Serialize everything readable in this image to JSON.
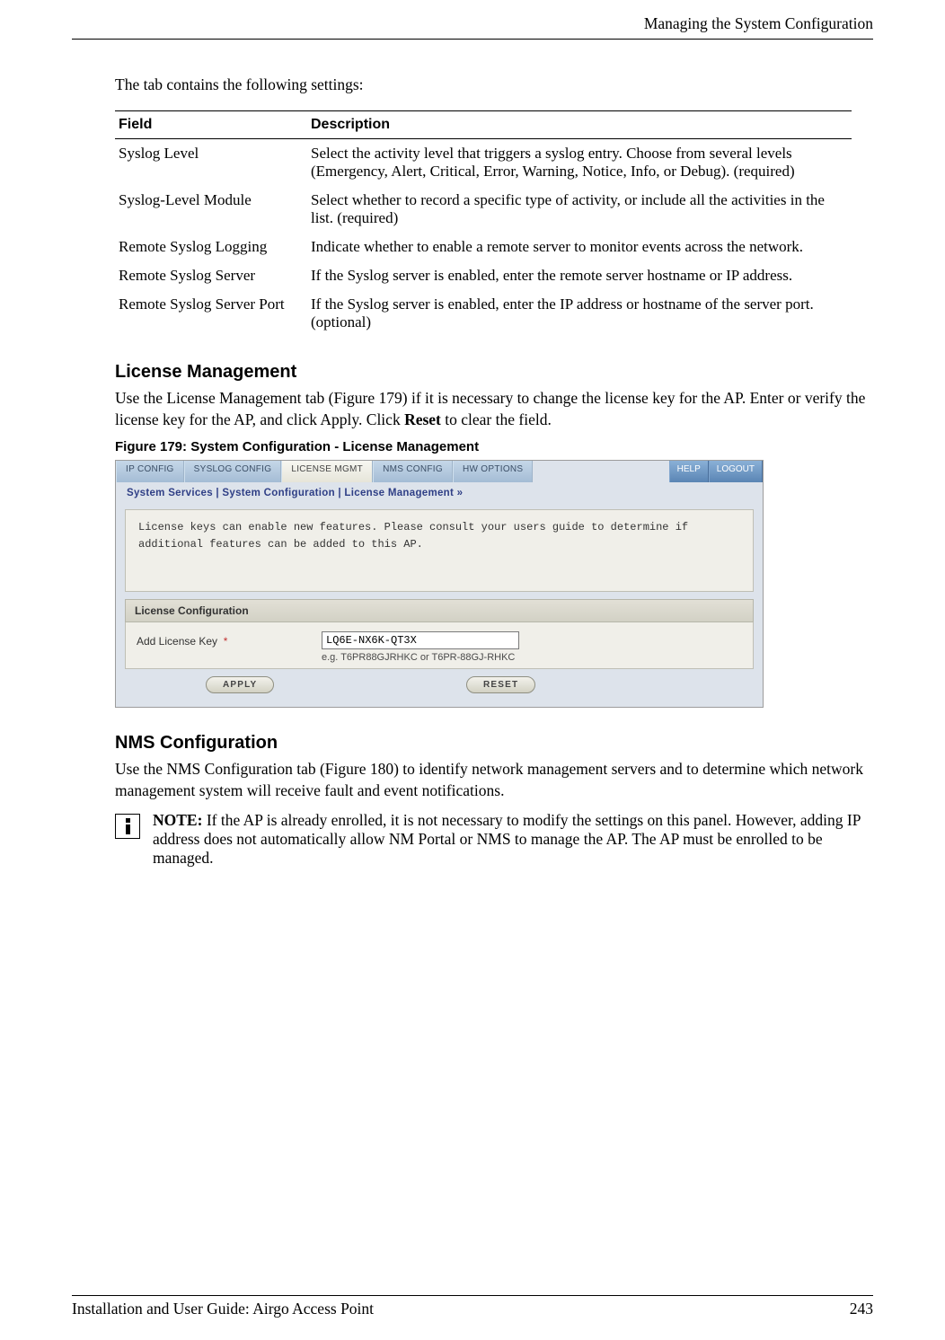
{
  "running_head": "Managing the System Configuration",
  "intro": "The tab contains the following settings:",
  "table": {
    "head_field": "Field",
    "head_desc": "Description",
    "rows": [
      {
        "field": "Syslog Level",
        "desc": "Select the activity level that triggers a syslog entry. Choose from several levels (Emergency, Alert, Critical, Error, Warning, Notice, Info, or Debug). (required)"
      },
      {
        "field": "Syslog-Level Module",
        "desc": "Select whether to record a specific type of activity, or include all the activities in the list. (required)"
      },
      {
        "field": "Remote Syslog Logging",
        "desc": "Indicate whether to enable a remote server to monitor events across the network."
      },
      {
        "field": "Remote Syslog Server",
        "desc": "If the Syslog server is enabled, enter the remote server hostname or IP address."
      },
      {
        "field": "Remote Syslog Server Port",
        "desc": "If the Syslog server is enabled, enter the IP address or hostname of the server port. (optional)"
      }
    ]
  },
  "section_license": {
    "title": "License Management",
    "para_before": "Use the License Management tab (Figure 179) if it is necessary to change the license key for the AP. Enter or verify the license key for the AP, and click Apply. Click ",
    "para_bold": "Reset",
    "para_after": " to clear the field.",
    "fig_caption": "Figure 179:    System Configuration - License Management"
  },
  "screenshot": {
    "tabs": {
      "ip": "IP CONFIG",
      "syslog": "SYSLOG CONFIG",
      "license": "LICENSE MGMT",
      "nms": "NMS CONFIG",
      "hw": "HW OPTIONS"
    },
    "help": "HELP",
    "logout": "LOGOUT",
    "breadcrumb": "System Services | System Configuration | License Management  »",
    "desc": "License keys can enable new features. Please consult your users guide to determine if additional features can be added to this AP.",
    "config_head": "License Configuration",
    "field_label": "Add License Key",
    "asterisk": "*",
    "input_value": "LQ6E-NX6K-QT3X",
    "hint": "e.g. T6PR88GJRHKC or T6PR-88GJ-RHKC",
    "apply": "APPLY",
    "reset": "RESET"
  },
  "section_nms": {
    "title": "NMS Configuration",
    "para": "Use the NMS Configuration tab (Figure 180) to identify network management servers and to determine which network management system will receive fault and event notifications.",
    "note_label": "NOTE: ",
    "note_body": "If the AP is already enrolled, it is not necessary to modify the settings on this panel. However, adding IP address does not automatically allow NM Portal or NMS to manage the AP. The AP must be enrolled to be managed."
  },
  "footer": {
    "left": "Installation and User Guide: Airgo Access Point",
    "right": "243"
  }
}
